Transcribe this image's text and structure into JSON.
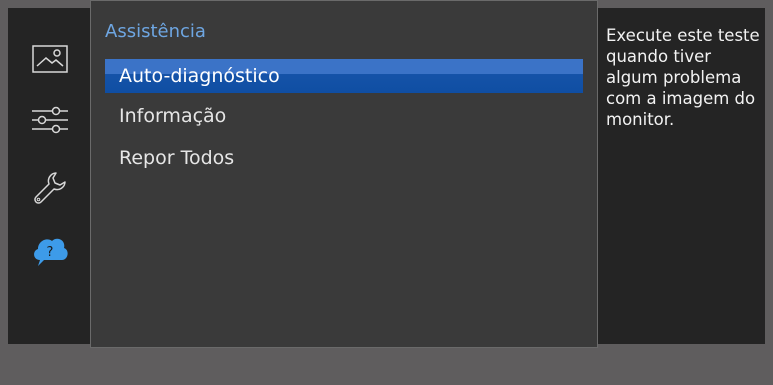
{
  "sidebar": {
    "items": [
      {
        "icon": "picture-icon"
      },
      {
        "icon": "settings-sliders-icon"
      },
      {
        "icon": "wrench-icon"
      },
      {
        "icon": "help-cloud-icon",
        "glyph": "?",
        "active": true
      }
    ]
  },
  "panel": {
    "title": "Assistência",
    "items": [
      {
        "label": "Auto-diagnóstico",
        "selected": true
      },
      {
        "label": "Informação",
        "selected": false
      },
      {
        "label": "Repor Todos",
        "selected": false
      }
    ]
  },
  "help": {
    "text": "Execute este teste quando tiver algum problema com a imagem do monitor."
  },
  "colors": {
    "accent": "#6ea6e2",
    "selection": "#1553a8",
    "help_icon": "#3d9be9"
  }
}
